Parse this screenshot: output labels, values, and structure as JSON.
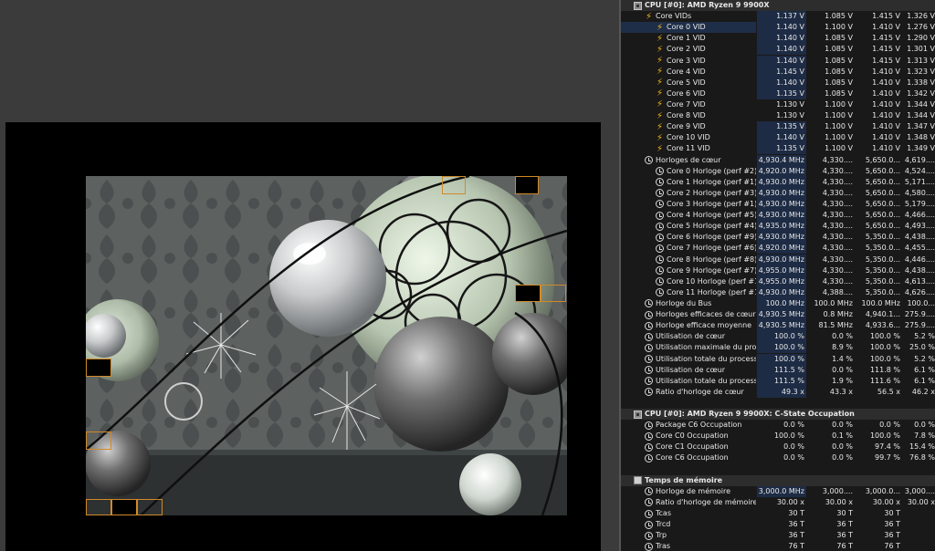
{
  "sensors": {
    "rows": [
      {
        "type": "header",
        "indent": 0,
        "exp": "⌄",
        "icon": "chip",
        "label": "CPU [#0]: AMD Ryzen 9 9900X",
        "v": [
          "",
          "",
          "",
          ""
        ]
      },
      {
        "indent": 1,
        "exp": "⌄",
        "icon": "bolt",
        "label": "Core VIDs",
        "v": [
          "1.137 V",
          "1.085 V",
          "1.415 V",
          "1.326 V"
        ]
      },
      {
        "indent": 2,
        "exp": "",
        "icon": "bolt",
        "label": "Core 0 VID",
        "v": [
          "1.140 V",
          "1.100 V",
          "1.410 V",
          "1.276 V"
        ],
        "selected": true
      },
      {
        "indent": 2,
        "exp": "",
        "icon": "bolt",
        "label": "Core 1 VID",
        "v": [
          "1.140 V",
          "1.085 V",
          "1.415 V",
          "1.290 V"
        ]
      },
      {
        "indent": 2,
        "exp": "",
        "icon": "bolt",
        "label": "Core 2 VID",
        "v": [
          "1.140 V",
          "1.085 V",
          "1.415 V",
          "1.301 V"
        ]
      },
      {
        "indent": 2,
        "exp": "",
        "icon": "bolt",
        "label": "Core 3 VID",
        "v": [
          "1.140 V",
          "1.085 V",
          "1.415 V",
          "1.313 V"
        ]
      },
      {
        "indent": 2,
        "exp": "",
        "icon": "bolt",
        "label": "Core 4 VID",
        "v": [
          "1.145 V",
          "1.085 V",
          "1.410 V",
          "1.323 V"
        ]
      },
      {
        "indent": 2,
        "exp": "",
        "icon": "bolt",
        "label": "Core 5 VID",
        "v": [
          "1.140 V",
          "1.085 V",
          "1.410 V",
          "1.338 V"
        ]
      },
      {
        "indent": 2,
        "exp": "",
        "icon": "bolt",
        "label": "Core 6 VID",
        "v": [
          "1.135 V",
          "1.085 V",
          "1.410 V",
          "1.342 V"
        ]
      },
      {
        "indent": 2,
        "exp": "",
        "icon": "bolt",
        "label": "Core 7 VID",
        "v": [
          "1.130 V",
          "1.100 V",
          "1.410 V",
          "1.344 V"
        ],
        "plain": true
      },
      {
        "indent": 2,
        "exp": "",
        "icon": "bolt",
        "label": "Core 8 VID",
        "v": [
          "1.130 V",
          "1.100 V",
          "1.410 V",
          "1.344 V"
        ],
        "plain": true
      },
      {
        "indent": 2,
        "exp": "",
        "icon": "bolt",
        "label": "Core 9 VID",
        "v": [
          "1.135 V",
          "1.100 V",
          "1.410 V",
          "1.347 V"
        ]
      },
      {
        "indent": 2,
        "exp": "",
        "icon": "bolt",
        "label": "Core 10 VID",
        "v": [
          "1.140 V",
          "1.100 V",
          "1.410 V",
          "1.348 V"
        ]
      },
      {
        "indent": 2,
        "exp": "",
        "icon": "bolt",
        "label": "Core 11 VID",
        "v": [
          "1.135 V",
          "1.100 V",
          "1.410 V",
          "1.349 V"
        ]
      },
      {
        "indent": 1,
        "exp": "⌄",
        "icon": "clock",
        "label": "Horloges de cœur",
        "v": [
          "4,930.4 MHz",
          "4,330....",
          "5,650.0...",
          "4,619...."
        ]
      },
      {
        "indent": 2,
        "exp": "",
        "icon": "clock",
        "label": "Core 0 Horloge (perf #2)",
        "v": [
          "4,920.0 MHz",
          "4,330....",
          "5,650.0...",
          "4,524...."
        ]
      },
      {
        "indent": 2,
        "exp": "",
        "icon": "clock",
        "label": "Core 1 Horloge (perf #1)",
        "v": [
          "4,930.0 MHz",
          "4,330....",
          "5,650.0...",
          "5,171...."
        ]
      },
      {
        "indent": 2,
        "exp": "",
        "icon": "clock",
        "label": "Core 2 Horloge (perf #3)",
        "v": [
          "4,930.0 MHz",
          "4,330....",
          "5,650.0...",
          "4,580...."
        ]
      },
      {
        "indent": 2,
        "exp": "",
        "icon": "clock",
        "label": "Core 3 Horloge (perf #1)",
        "v": [
          "4,930.0 MHz",
          "4,330....",
          "5,650.0...",
          "5,179...."
        ]
      },
      {
        "indent": 2,
        "exp": "",
        "icon": "clock",
        "label": "Core 4 Horloge (perf #5)",
        "v": [
          "4,930.0 MHz",
          "4,330....",
          "5,650.0...",
          "4,466...."
        ]
      },
      {
        "indent": 2,
        "exp": "",
        "icon": "clock",
        "label": "Core 5 Horloge (perf #4)",
        "v": [
          "4,935.0 MHz",
          "4,330....",
          "5,650.0...",
          "4,493...."
        ]
      },
      {
        "indent": 2,
        "exp": "",
        "icon": "clock",
        "label": "Core 6 Horloge (perf #9)",
        "v": [
          "4,930.0 MHz",
          "4,330....",
          "5,350.0...",
          "4,438...."
        ]
      },
      {
        "indent": 2,
        "exp": "",
        "icon": "clock",
        "label": "Core 7 Horloge (perf #6)",
        "v": [
          "4,920.0 MHz",
          "4,330....",
          "5,350.0...",
          "4,455...."
        ]
      },
      {
        "indent": 2,
        "exp": "",
        "icon": "clock",
        "label": "Core 8 Horloge (perf #8)",
        "v": [
          "4,930.0 MHz",
          "4,330....",
          "5,350.0...",
          "4,446...."
        ]
      },
      {
        "indent": 2,
        "exp": "",
        "icon": "clock",
        "label": "Core 9 Horloge (perf #7)",
        "v": [
          "4,955.0 MHz",
          "4,330....",
          "5,350.0...",
          "4,438...."
        ]
      },
      {
        "indent": 2,
        "exp": "",
        "icon": "clock",
        "label": "Core 10 Horloge (perf #11)",
        "v": [
          "4,955.0 MHz",
          "4,330....",
          "5,350.0...",
          "4,613...."
        ]
      },
      {
        "indent": 2,
        "exp": "",
        "icon": "clock",
        "label": "Core 11 Horloge (perf #10)",
        "v": [
          "4,930.0 MHz",
          "4,388....",
          "5,350.0...",
          "4,626...."
        ]
      },
      {
        "indent": 1,
        "exp": "",
        "icon": "clock",
        "label": "Horloge du Bus",
        "v": [
          "100.0 MHz",
          "100.0 MHz",
          "100.0 MHz",
          "100.0..."
        ]
      },
      {
        "indent": 1,
        "exp": "›",
        "icon": "clock",
        "label": "Horloges efficaces de cœur",
        "v": [
          "4,930.5 MHz",
          "0.8 MHz",
          "4,940.1...",
          "275.9...."
        ]
      },
      {
        "indent": 1,
        "exp": "",
        "icon": "clock",
        "label": "Horloge efficace moyenne",
        "v": [
          "4,930.5 MHz",
          "81.5 MHz",
          "4,933.6...",
          "275.9...."
        ]
      },
      {
        "indent": 1,
        "exp": "›",
        "icon": "clock",
        "label": "Utilisation de cœur",
        "v": [
          "100.0 %",
          "0.0 %",
          "100.0 %",
          "5.2 %"
        ]
      },
      {
        "indent": 1,
        "exp": "",
        "icon": "clock",
        "label": "Utilisation maximale du process...",
        "v": [
          "100.0 %",
          "8.9 %",
          "100.0 %",
          "25.0 %"
        ]
      },
      {
        "indent": 1,
        "exp": "",
        "icon": "clock",
        "label": "Utilisation totale du processeur",
        "v": [
          "100.0 %",
          "1.4 %",
          "100.0 %",
          "5.2 %"
        ]
      },
      {
        "indent": 1,
        "exp": "›",
        "icon": "clock",
        "label": "Utilisation de cœur",
        "v": [
          "111.5 %",
          "0.0 %",
          "111.8 %",
          "6.1 %"
        ]
      },
      {
        "indent": 1,
        "exp": "",
        "icon": "clock",
        "label": "Utilisation totale du processeur",
        "v": [
          "111.5 %",
          "1.9 %",
          "111.6 %",
          "6.1 %"
        ]
      },
      {
        "indent": 1,
        "exp": "›",
        "icon": "clock",
        "label": "Ratio d'horloge de cœur",
        "v": [
          "49.3 x",
          "43.3 x",
          "56.5 x",
          "46.2 x"
        ]
      },
      {
        "type": "spacer"
      },
      {
        "type": "header",
        "indent": 0,
        "exp": "⌄",
        "icon": "chip",
        "label": "CPU [#0]: AMD Ryzen 9 9900X: C-State Occupation",
        "v": [
          "",
          "",
          "",
          ""
        ]
      },
      {
        "indent": 1,
        "exp": "",
        "icon": "clock",
        "label": "Package C6 Occupation",
        "v": [
          "0.0 %",
          "0.0 %",
          "0.0 %",
          "0.0 %"
        ],
        "plain": true
      },
      {
        "indent": 1,
        "exp": "›",
        "icon": "clock",
        "label": "Core C0 Occupation",
        "v": [
          "100.0 %",
          "0.1 %",
          "100.0 %",
          "7.8 %"
        ],
        "plain": true
      },
      {
        "indent": 1,
        "exp": "›",
        "icon": "clock",
        "label": "Core C1 Occupation",
        "v": [
          "0.0 %",
          "0.0 %",
          "97.4 %",
          "15.4 %"
        ],
        "plain": true
      },
      {
        "indent": 1,
        "exp": "›",
        "icon": "clock",
        "label": "Core C6 Occupation",
        "v": [
          "0.0 %",
          "0.0 %",
          "99.7 %",
          "76.8 %"
        ],
        "plain": true
      },
      {
        "type": "spacer"
      },
      {
        "type": "header",
        "indent": 0,
        "exp": "⌄",
        "icon": "mem",
        "label": "Temps de mémoire",
        "v": [
          "",
          "",
          "",
          ""
        ]
      },
      {
        "indent": 1,
        "exp": "",
        "icon": "clock",
        "label": "Horloge de mémoire",
        "v": [
          "3,000.0 MHz",
          "3,000....",
          "3,000.0...",
          "3,000...."
        ]
      },
      {
        "indent": 1,
        "exp": "",
        "icon": "clock",
        "label": "Ratio d'horloge de mémoire",
        "v": [
          "30.00 x",
          "30.00 x",
          "30.00 x",
          "30.00 x"
        ],
        "plain": true
      },
      {
        "indent": 1,
        "exp": "",
        "icon": "clock",
        "label": "Tcas",
        "v": [
          "30 T",
          "30 T",
          "30 T",
          ""
        ],
        "plain": true
      },
      {
        "indent": 1,
        "exp": "",
        "icon": "clock",
        "label": "Trcd",
        "v": [
          "36 T",
          "36 T",
          "36 T",
          ""
        ],
        "plain": true
      },
      {
        "indent": 1,
        "exp": "",
        "icon": "clock",
        "label": "Trp",
        "v": [
          "36 T",
          "36 T",
          "36 T",
          ""
        ],
        "plain": true
      },
      {
        "indent": 1,
        "exp": "",
        "icon": "clock",
        "label": "Tras",
        "v": [
          "76 T",
          "76 T",
          "76 T",
          ""
        ],
        "plain": true
      }
    ]
  },
  "render": {
    "tile_color": "#d08a2a"
  }
}
